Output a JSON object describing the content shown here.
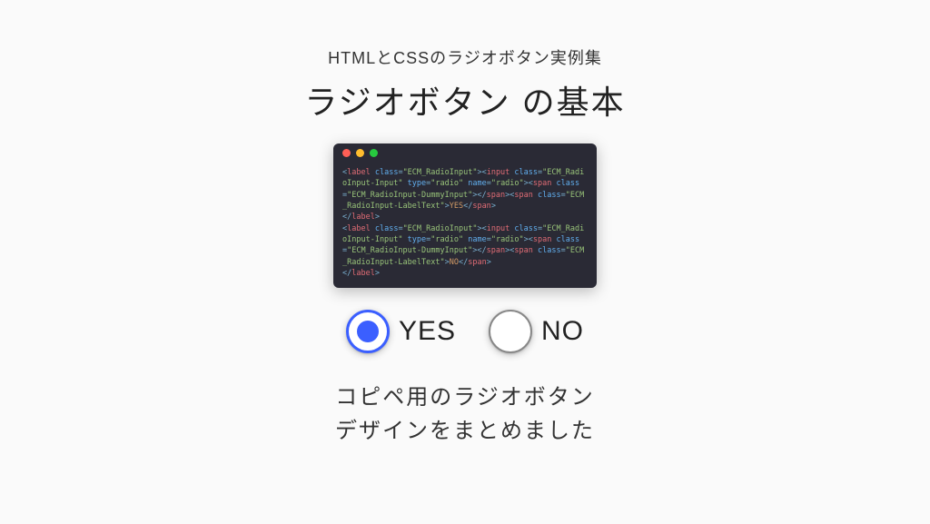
{
  "header": {
    "subtitle": "HTMLとCSSのラジオボタン実例集",
    "title": "ラジオボタン の基本"
  },
  "codeWindow": {
    "lines": [
      {
        "t": "open",
        "tag": "label",
        "attrs": [
          {
            "n": "class",
            "v": "ECM_RadioInput"
          }
        ],
        "inlineNext": true
      },
      {
        "t": "open",
        "tag": "input",
        "attrs": [
          {
            "n": "class",
            "v": "ECM_RadioInput-Input"
          },
          {
            "n": "type",
            "v": "radio"
          },
          {
            "n": "name",
            "v": "radio"
          }
        ],
        "inlineNext": true
      },
      {
        "t": "open",
        "tag": "span",
        "attrs": [
          {
            "n": "class",
            "v": "ECM_RadioInput-DummyInput"
          }
        ],
        "inlineNext": true
      },
      {
        "t": "close",
        "tag": "span",
        "inlineNext": true
      },
      {
        "t": "open",
        "tag": "span",
        "attrs": [
          {
            "n": "class",
            "v": "ECM_RadioInput-LabelText"
          }
        ],
        "inlineNext": true
      },
      {
        "t": "text",
        "v": "YES",
        "inlineNext": true
      },
      {
        "t": "close",
        "tag": "span"
      },
      {
        "t": "close",
        "tag": "label"
      },
      {
        "t": "open",
        "tag": "label",
        "attrs": [
          {
            "n": "class",
            "v": "ECM_RadioInput"
          }
        ],
        "inlineNext": true
      },
      {
        "t": "open",
        "tag": "input",
        "attrs": [
          {
            "n": "class",
            "v": "ECM_RadioInput-Input"
          },
          {
            "n": "type",
            "v": "radio"
          },
          {
            "n": "name",
            "v": "radio"
          }
        ],
        "inlineNext": true
      },
      {
        "t": "open",
        "tag": "span",
        "attrs": [
          {
            "n": "class",
            "v": "ECM_RadioInput-DummyInput"
          }
        ],
        "inlineNext": true
      },
      {
        "t": "close",
        "tag": "span",
        "inlineNext": true
      },
      {
        "t": "open",
        "tag": "span",
        "attrs": [
          {
            "n": "class",
            "v": "ECM_RadioInput-LabelText"
          }
        ],
        "inlineNext": true
      },
      {
        "t": "text",
        "v": "NO",
        "inlineNext": true
      },
      {
        "t": "close",
        "tag": "span"
      },
      {
        "t": "close",
        "tag": "label"
      }
    ]
  },
  "radios": {
    "options": [
      {
        "label": "YES",
        "selected": true
      },
      {
        "label": "NO",
        "selected": false
      }
    ]
  },
  "caption": {
    "line1": "コピペ用のラジオボタン",
    "line2": "デザインをまとめました"
  },
  "colors": {
    "accent": "#3b5fff",
    "codeBg": "#2a2a35"
  }
}
